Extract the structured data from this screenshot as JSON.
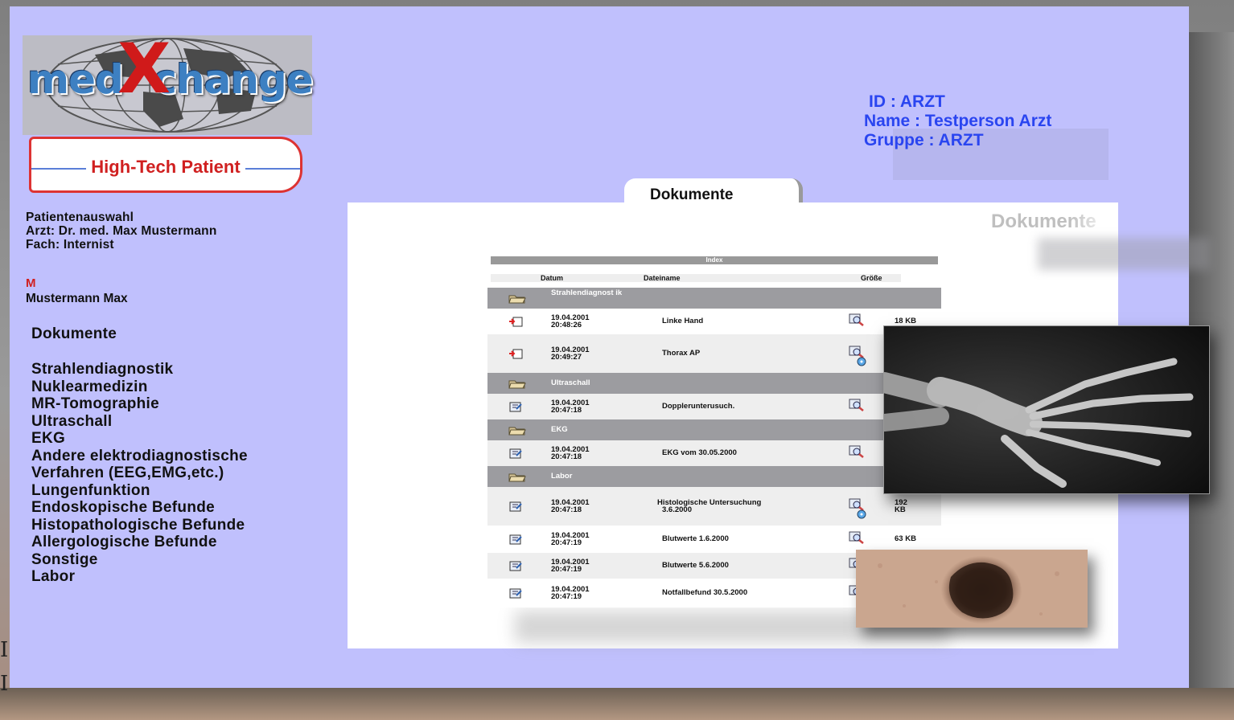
{
  "logo": {
    "brand": "medXchange",
    "brand_left": "med",
    "brand_x": "X",
    "brand_right": "change"
  },
  "banner": {
    "label": "High-Tech Patient"
  },
  "patient_info": {
    "line1": "Patientenauswahl",
    "line2": "Arzt: Dr. med. Max Mustermann",
    "line3": "Fach: Internist",
    "marker": "M",
    "patient_name": "Mustermann Max"
  },
  "nav": {
    "documents_heading": "Dokumente",
    "categories": [
      "Strahlendiagnostik",
      "Nuklearmedizin",
      "MR-Tomographie",
      "Ultraschall",
      "EKG",
      "Andere elektrodiagnostische",
      "Verfahren (EEG,EMG,etc.)",
      "Lungenfunktion",
      "Endoskopische Befunde",
      "Histopathologische Befunde",
      "Allergologische Befunde",
      "Sonstige",
      "Labor"
    ]
  },
  "user": {
    "id": "ID : ARZT",
    "name": "Name : Testperson Arzt",
    "group": "Gruppe : ARZT"
  },
  "tab": {
    "label": "Dokumente"
  },
  "panel": {
    "title": "Dokumente"
  },
  "index": {
    "title": "Index",
    "col_date": "Datum",
    "col_file": "Dateiname",
    "col_size": "Größe",
    "rows": [
      {
        "type": "group",
        "name": "Strahlendiagnost ik"
      },
      {
        "type": "file",
        "date": "19.04.2001",
        "time": "20:48:26",
        "name": "Linke Hand",
        "size": "18 KB",
        "icon": "red-document-icon"
      },
      {
        "type": "file",
        "date": "19.04.2001",
        "time": "20:49:27",
        "name": "Thorax AP",
        "size": "",
        "icon": "red-document-icon"
      },
      {
        "type": "group",
        "name": "Ultraschall"
      },
      {
        "type": "file",
        "date": "19.04.2001",
        "time": "20:47:18",
        "name": "Dopplerunterusuch.",
        "size": "",
        "icon": "document-icon"
      },
      {
        "type": "group",
        "name": "EKG"
      },
      {
        "type": "file",
        "date": "19.04.2001",
        "time": "20:47:18",
        "name": "EKG vom 30.05.2000",
        "size": "",
        "icon": "document-icon"
      },
      {
        "type": "group",
        "name": "Labor"
      },
      {
        "type": "file",
        "date": "19.04.2001",
        "time": "20:47:18",
        "name": "Histologische Untersuchung",
        "name2": "3.6.2000",
        "size": "192",
        "size2": "KB",
        "icon": "document-icon"
      },
      {
        "type": "file",
        "date": "19.04.2001",
        "time": "20:47:19",
        "name": "Blutwerte 1.6.2000",
        "size": "63 KB",
        "icon": "document-icon"
      },
      {
        "type": "file",
        "date": "19.04.2001",
        "time": "20:47:19",
        "name": "Blutwerte 5.6.2000",
        "size": "",
        "icon": "document-icon"
      },
      {
        "type": "file",
        "date": "19.04.2001",
        "time": "20:47:19",
        "name": "Notfallbefund 30.5.2000",
        "size": "",
        "icon": "document-icon"
      }
    ]
  },
  "stray": {
    "a": "I",
    "b": "I"
  },
  "colors": {
    "frame": "#c0c0fd",
    "user_text": "#2a45f0",
    "accent_red": "#d02020"
  }
}
